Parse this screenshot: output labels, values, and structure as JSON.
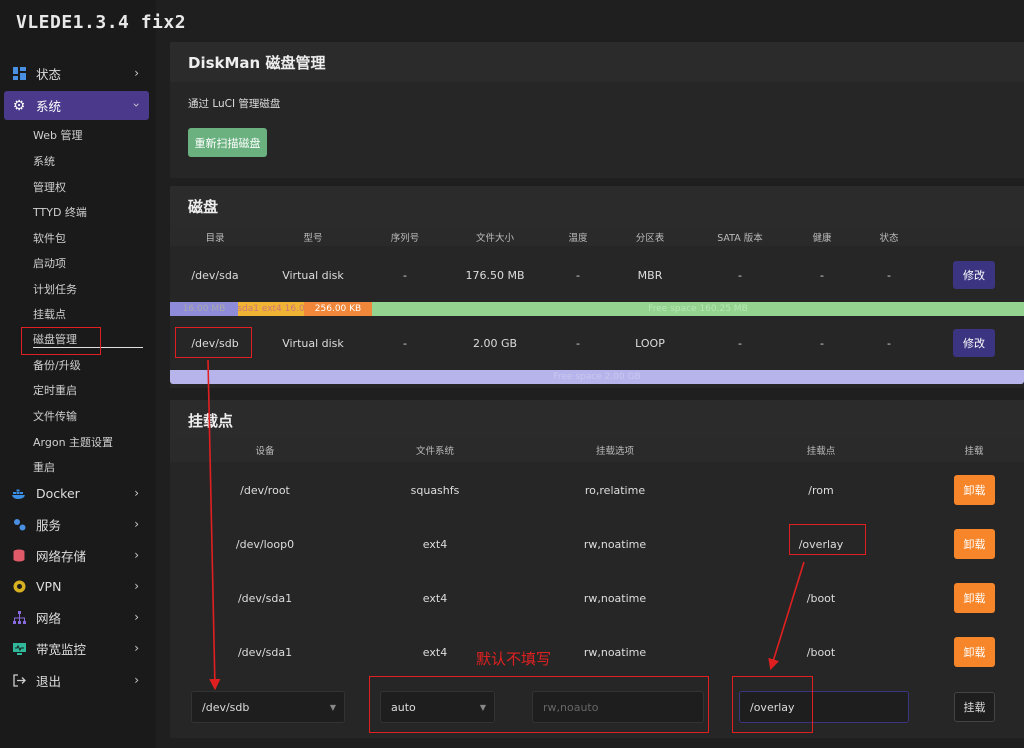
{
  "brand": "VLEDE1.3.4 fix2",
  "sidebar": {
    "top": [
      {
        "label": "状态",
        "icon": "dashboard-icon"
      },
      {
        "label": "系统",
        "icon": "gear-icon"
      }
    ],
    "sub": [
      "Web 管理",
      "系统",
      "管理权",
      "TTYD 终端",
      "软件包",
      "启动项",
      "计划任务",
      "挂载点",
      "磁盘管理",
      "备份/升级",
      "定时重启",
      "文件传输",
      "Argon 主题设置",
      "重启"
    ],
    "bottom": [
      {
        "label": "Docker",
        "icon": "docker-icon"
      },
      {
        "label": "服务",
        "icon": "services-icon"
      },
      {
        "label": "网络存储",
        "icon": "storage-icon"
      },
      {
        "label": "VPN",
        "icon": "vpn-icon"
      },
      {
        "label": "网络",
        "icon": "network-icon"
      },
      {
        "label": "带宽监控",
        "icon": "monitor-icon"
      },
      {
        "label": "退出",
        "icon": "logout-icon"
      }
    ]
  },
  "header": {
    "title": "DiskMan 磁盘管理",
    "desc": "通过 LuCI 管理磁盘",
    "rescan": "重新扫描磁盘"
  },
  "disks": {
    "title": "磁盘",
    "cols": [
      "目录",
      "型号",
      "序列号",
      "文件大小",
      "温度",
      "分区表",
      "SATA 版本",
      "健康",
      "状态"
    ],
    "rows": [
      {
        "path": "/dev/sda",
        "model": "Virtual disk",
        "serial": "-",
        "size": "176.50 MB",
        "temp": "-",
        "table": "MBR",
        "sata": "-",
        "health": "-",
        "status": "-",
        "action": "修改"
      },
      {
        "path": "/dev/sdb",
        "model": "Virtual disk",
        "serial": "-",
        "size": "2.00 GB",
        "temp": "-",
        "table": "LOOP",
        "sata": "-",
        "health": "-",
        "status": "-",
        "action": "修改"
      }
    ],
    "sda_bar": {
      "seg1": "16.00 MB",
      "seg2": "sda1 ext4 16.0",
      "seg3": "256.00 KB",
      "seg4": "Free space 160.25 MB"
    },
    "sdb_bar": "Free space 2.00 GB"
  },
  "mounts": {
    "title": "挂载点",
    "cols": [
      "设备",
      "文件系统",
      "挂载选项",
      "挂载点",
      "挂载"
    ],
    "rows": [
      {
        "device": "/dev/root",
        "fs": "squashfs",
        "opts": "ro,relatime",
        "point": "/rom",
        "action": "卸载"
      },
      {
        "device": "/dev/loop0",
        "fs": "ext4",
        "opts": "rw,noatime",
        "point": "/overlay",
        "action": "卸载"
      },
      {
        "device": "/dev/sda1",
        "fs": "ext4",
        "opts": "rw,noatime",
        "point": "/boot",
        "action": "卸载"
      },
      {
        "device": "/dev/sda1",
        "fs": "ext4",
        "opts": "rw,noatime",
        "point": "/boot",
        "action": "卸载"
      }
    ],
    "form": {
      "device": "/dev/sdb",
      "fs": "auto",
      "opts_placeholder": "rw,noauto",
      "point": "/overlay",
      "mount": "挂载"
    }
  },
  "annotation": "默认不填写",
  "colors": {
    "accent": "#4b3a8c",
    "green": "#6ab17f",
    "orange": "#f7862a",
    "red": "#e02020"
  }
}
